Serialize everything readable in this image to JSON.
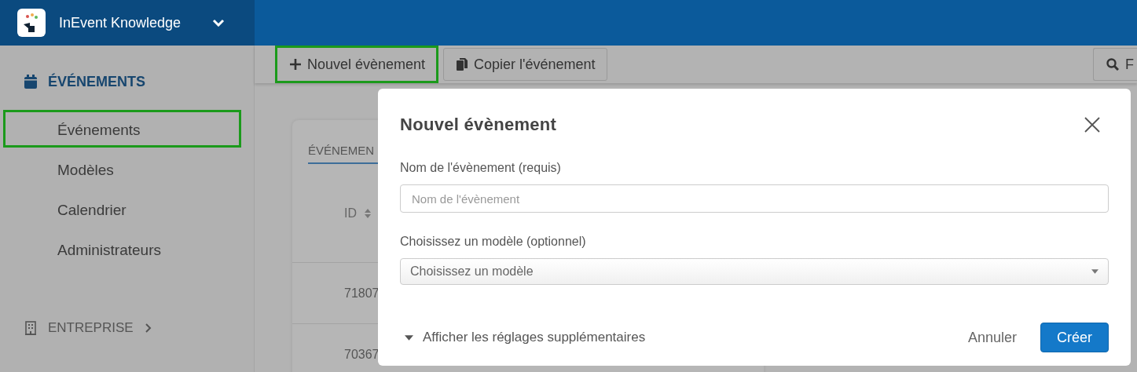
{
  "header": {
    "workspace": "InEvent Knowledge"
  },
  "sidebar": {
    "section": "ÉVÉNEMENTS",
    "items": [
      {
        "label": "Événements",
        "highlighted": true
      },
      {
        "label": "Modèles",
        "highlighted": false
      },
      {
        "label": "Calendrier",
        "highlighted": false
      },
      {
        "label": "Administrateurs",
        "highlighted": false
      }
    ],
    "footer": "ENTREPRISE"
  },
  "toolbar": {
    "buttons": [
      {
        "kind": "new",
        "label": "Nouvel évènement",
        "highlighted": true
      },
      {
        "kind": "copy",
        "label": "Copier l'événement",
        "highlighted": false
      }
    ],
    "search_button": "F"
  },
  "card": {
    "tab": "ÉVÉNEMEN",
    "column_1": "ID",
    "rows": [
      "71807",
      "70367"
    ]
  },
  "dialog": {
    "title": "Nouvel évènement",
    "fields": [
      {
        "kind": "text",
        "label": "Nom de l'évènement (requis)",
        "placeholder": "Nom de l'évènement"
      },
      {
        "kind": "select",
        "label": "Choisissez un modèle (optionnel)",
        "value": "Choisissez un modèle"
      }
    ],
    "more_settings": "Afficher les réglages supplémentaires",
    "cancel": "Annuler",
    "submit": "Créer"
  }
}
